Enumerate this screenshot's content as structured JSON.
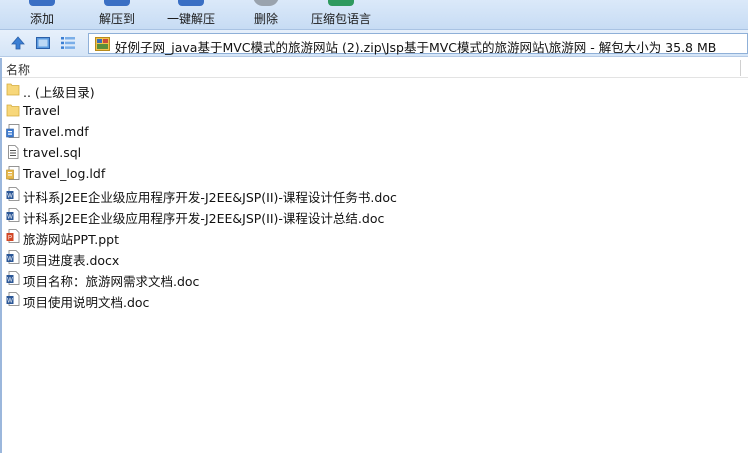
{
  "toolbar": {
    "buttons": [
      {
        "label": "添加",
        "icon": "add-icon",
        "color": "#3a6fc4"
      },
      {
        "label": "解压到",
        "icon": "extract-to-icon",
        "color": "#3a6fc4"
      },
      {
        "label": "一键解压",
        "icon": "one-click-extract-icon",
        "color": "#3a6fc4"
      },
      {
        "label": "删除",
        "icon": "delete-icon",
        "color": "#8a8a8a"
      },
      {
        "label": "压缩包语言",
        "icon": "archive-language-icon",
        "color": "#2f9a5e"
      }
    ]
  },
  "address": {
    "path": "好例子网_java基于MVC模式的旅游网站 (2).zip\\Jsp基于MVC模式的旅游网站\\旅游网 - 解包大小为 35.8 MB"
  },
  "list": {
    "column_name": "名称",
    "items": [
      {
        "name": ".. (上级目录)",
        "icon": "parent-folder-icon"
      },
      {
        "name": "Travel",
        "icon": "folder-icon"
      },
      {
        "name": "Travel.mdf",
        "icon": "database-file-icon"
      },
      {
        "name": "travel.sql",
        "icon": "sql-file-icon"
      },
      {
        "name": "Travel_log.ldf",
        "icon": "log-file-icon"
      },
      {
        "name": "计科系J2EE企业级应用程序开发-J2EE&JSP(II)-课程设计任务书.doc",
        "icon": "word-doc-icon"
      },
      {
        "name": "计科系J2EE企业级应用程序开发-J2EE&JSP(II)-课程设计总结.doc",
        "icon": "word-doc-icon"
      },
      {
        "name": "旅游网站PPT.ppt",
        "icon": "ppt-file-icon"
      },
      {
        "name": "项目进度表.docx",
        "icon": "word-doc-icon"
      },
      {
        "name": "项目名称：旅游网需求文档.doc",
        "icon": "word-doc-icon"
      },
      {
        "name": "项目使用说明文档.doc",
        "icon": "word-doc-icon"
      }
    ]
  }
}
